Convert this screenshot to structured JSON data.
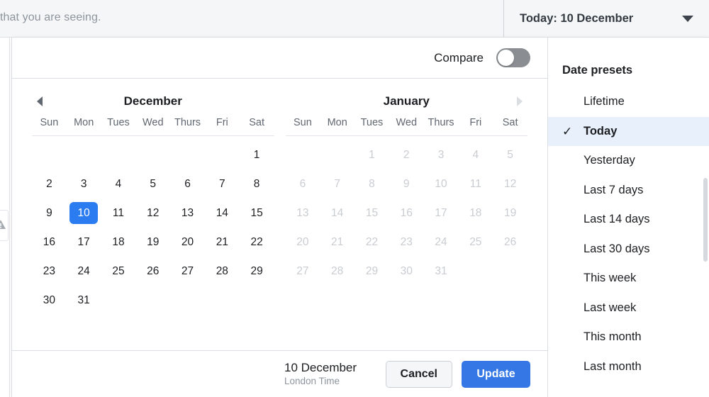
{
  "background": {
    "help_text": "that you are seeing.",
    "warning_icon": "warning-triangle-icon"
  },
  "range_trigger": {
    "label": "Today: 10 December",
    "caret_icon": "chevron-down-icon"
  },
  "popover": {
    "compare": {
      "label": "Compare",
      "enabled": false
    },
    "nav": {
      "prev_icon": "chevron-left-icon",
      "next_icon": "chevron-right-icon",
      "prev_enabled": true,
      "next_enabled": false
    },
    "weekdays": [
      "Sun",
      "Mon",
      "Tues",
      "Wed",
      "Thurs",
      "Fri",
      "Sat"
    ],
    "months": [
      {
        "title": "December",
        "leading_blanks": 6,
        "days": [
          {
            "n": "1",
            "state": "normal"
          },
          {
            "n": "2",
            "state": "normal"
          },
          {
            "n": "3",
            "state": "normal"
          },
          {
            "n": "4",
            "state": "normal"
          },
          {
            "n": "5",
            "state": "normal"
          },
          {
            "n": "6",
            "state": "normal"
          },
          {
            "n": "7",
            "state": "normal"
          },
          {
            "n": "8",
            "state": "normal"
          },
          {
            "n": "9",
            "state": "normal"
          },
          {
            "n": "10",
            "state": "selected"
          },
          {
            "n": "11",
            "state": "normal"
          },
          {
            "n": "12",
            "state": "normal"
          },
          {
            "n": "13",
            "state": "normal"
          },
          {
            "n": "14",
            "state": "normal"
          },
          {
            "n": "15",
            "state": "normal"
          },
          {
            "n": "16",
            "state": "normal"
          },
          {
            "n": "17",
            "state": "normal"
          },
          {
            "n": "18",
            "state": "normal"
          },
          {
            "n": "19",
            "state": "normal"
          },
          {
            "n": "20",
            "state": "normal"
          },
          {
            "n": "21",
            "state": "normal"
          },
          {
            "n": "22",
            "state": "normal"
          },
          {
            "n": "23",
            "state": "normal"
          },
          {
            "n": "24",
            "state": "normal"
          },
          {
            "n": "25",
            "state": "normal"
          },
          {
            "n": "26",
            "state": "normal"
          },
          {
            "n": "27",
            "state": "normal"
          },
          {
            "n": "28",
            "state": "normal"
          },
          {
            "n": "29",
            "state": "normal"
          },
          {
            "n": "30",
            "state": "normal"
          },
          {
            "n": "31",
            "state": "normal"
          }
        ]
      },
      {
        "title": "January",
        "leading_blanks": 2,
        "days": [
          {
            "n": "1",
            "state": "muted"
          },
          {
            "n": "2",
            "state": "muted"
          },
          {
            "n": "3",
            "state": "muted"
          },
          {
            "n": "4",
            "state": "muted"
          },
          {
            "n": "5",
            "state": "muted"
          },
          {
            "n": "6",
            "state": "muted"
          },
          {
            "n": "7",
            "state": "muted"
          },
          {
            "n": "8",
            "state": "muted"
          },
          {
            "n": "9",
            "state": "muted"
          },
          {
            "n": "10",
            "state": "muted"
          },
          {
            "n": "11",
            "state": "muted"
          },
          {
            "n": "12",
            "state": "muted"
          },
          {
            "n": "13",
            "state": "muted"
          },
          {
            "n": "14",
            "state": "muted"
          },
          {
            "n": "15",
            "state": "muted"
          },
          {
            "n": "16",
            "state": "muted"
          },
          {
            "n": "17",
            "state": "muted"
          },
          {
            "n": "18",
            "state": "muted"
          },
          {
            "n": "19",
            "state": "muted"
          },
          {
            "n": "20",
            "state": "muted"
          },
          {
            "n": "21",
            "state": "muted"
          },
          {
            "n": "22",
            "state": "muted"
          },
          {
            "n": "23",
            "state": "muted"
          },
          {
            "n": "24",
            "state": "muted"
          },
          {
            "n": "25",
            "state": "muted"
          },
          {
            "n": "26",
            "state": "muted"
          },
          {
            "n": "27",
            "state": "muted"
          },
          {
            "n": "28",
            "state": "muted"
          },
          {
            "n": "29",
            "state": "muted"
          },
          {
            "n": "30",
            "state": "muted"
          },
          {
            "n": "31",
            "state": "muted"
          }
        ]
      }
    ],
    "footer": {
      "selected_date": "10 December",
      "timezone": "London Time",
      "cancel_label": "Cancel",
      "update_label": "Update"
    },
    "presets": {
      "title": "Date presets",
      "check_glyph": "✓",
      "items": [
        {
          "label": "Lifetime",
          "selected": false
        },
        {
          "label": "Today",
          "selected": true
        },
        {
          "label": "Yesterday",
          "selected": false
        },
        {
          "label": "Last 7 days",
          "selected": false
        },
        {
          "label": "Last 14 days",
          "selected": false
        },
        {
          "label": "Last 30 days",
          "selected": false
        },
        {
          "label": "This week",
          "selected": false
        },
        {
          "label": "Last week",
          "selected": false
        },
        {
          "label": "This month",
          "selected": false
        },
        {
          "label": "Last month",
          "selected": false
        }
      ]
    }
  },
  "colors": {
    "accent_blue": "#3578e5",
    "selected_day_blue": "#2b7cf0",
    "preset_selected_bg": "#e7f0fb",
    "page_bg": "#f5f6f7",
    "border": "#dadde1",
    "text_primary": "#1c1e21",
    "text_muted": "#8d949e",
    "day_disabled": "#c9ccd1"
  }
}
